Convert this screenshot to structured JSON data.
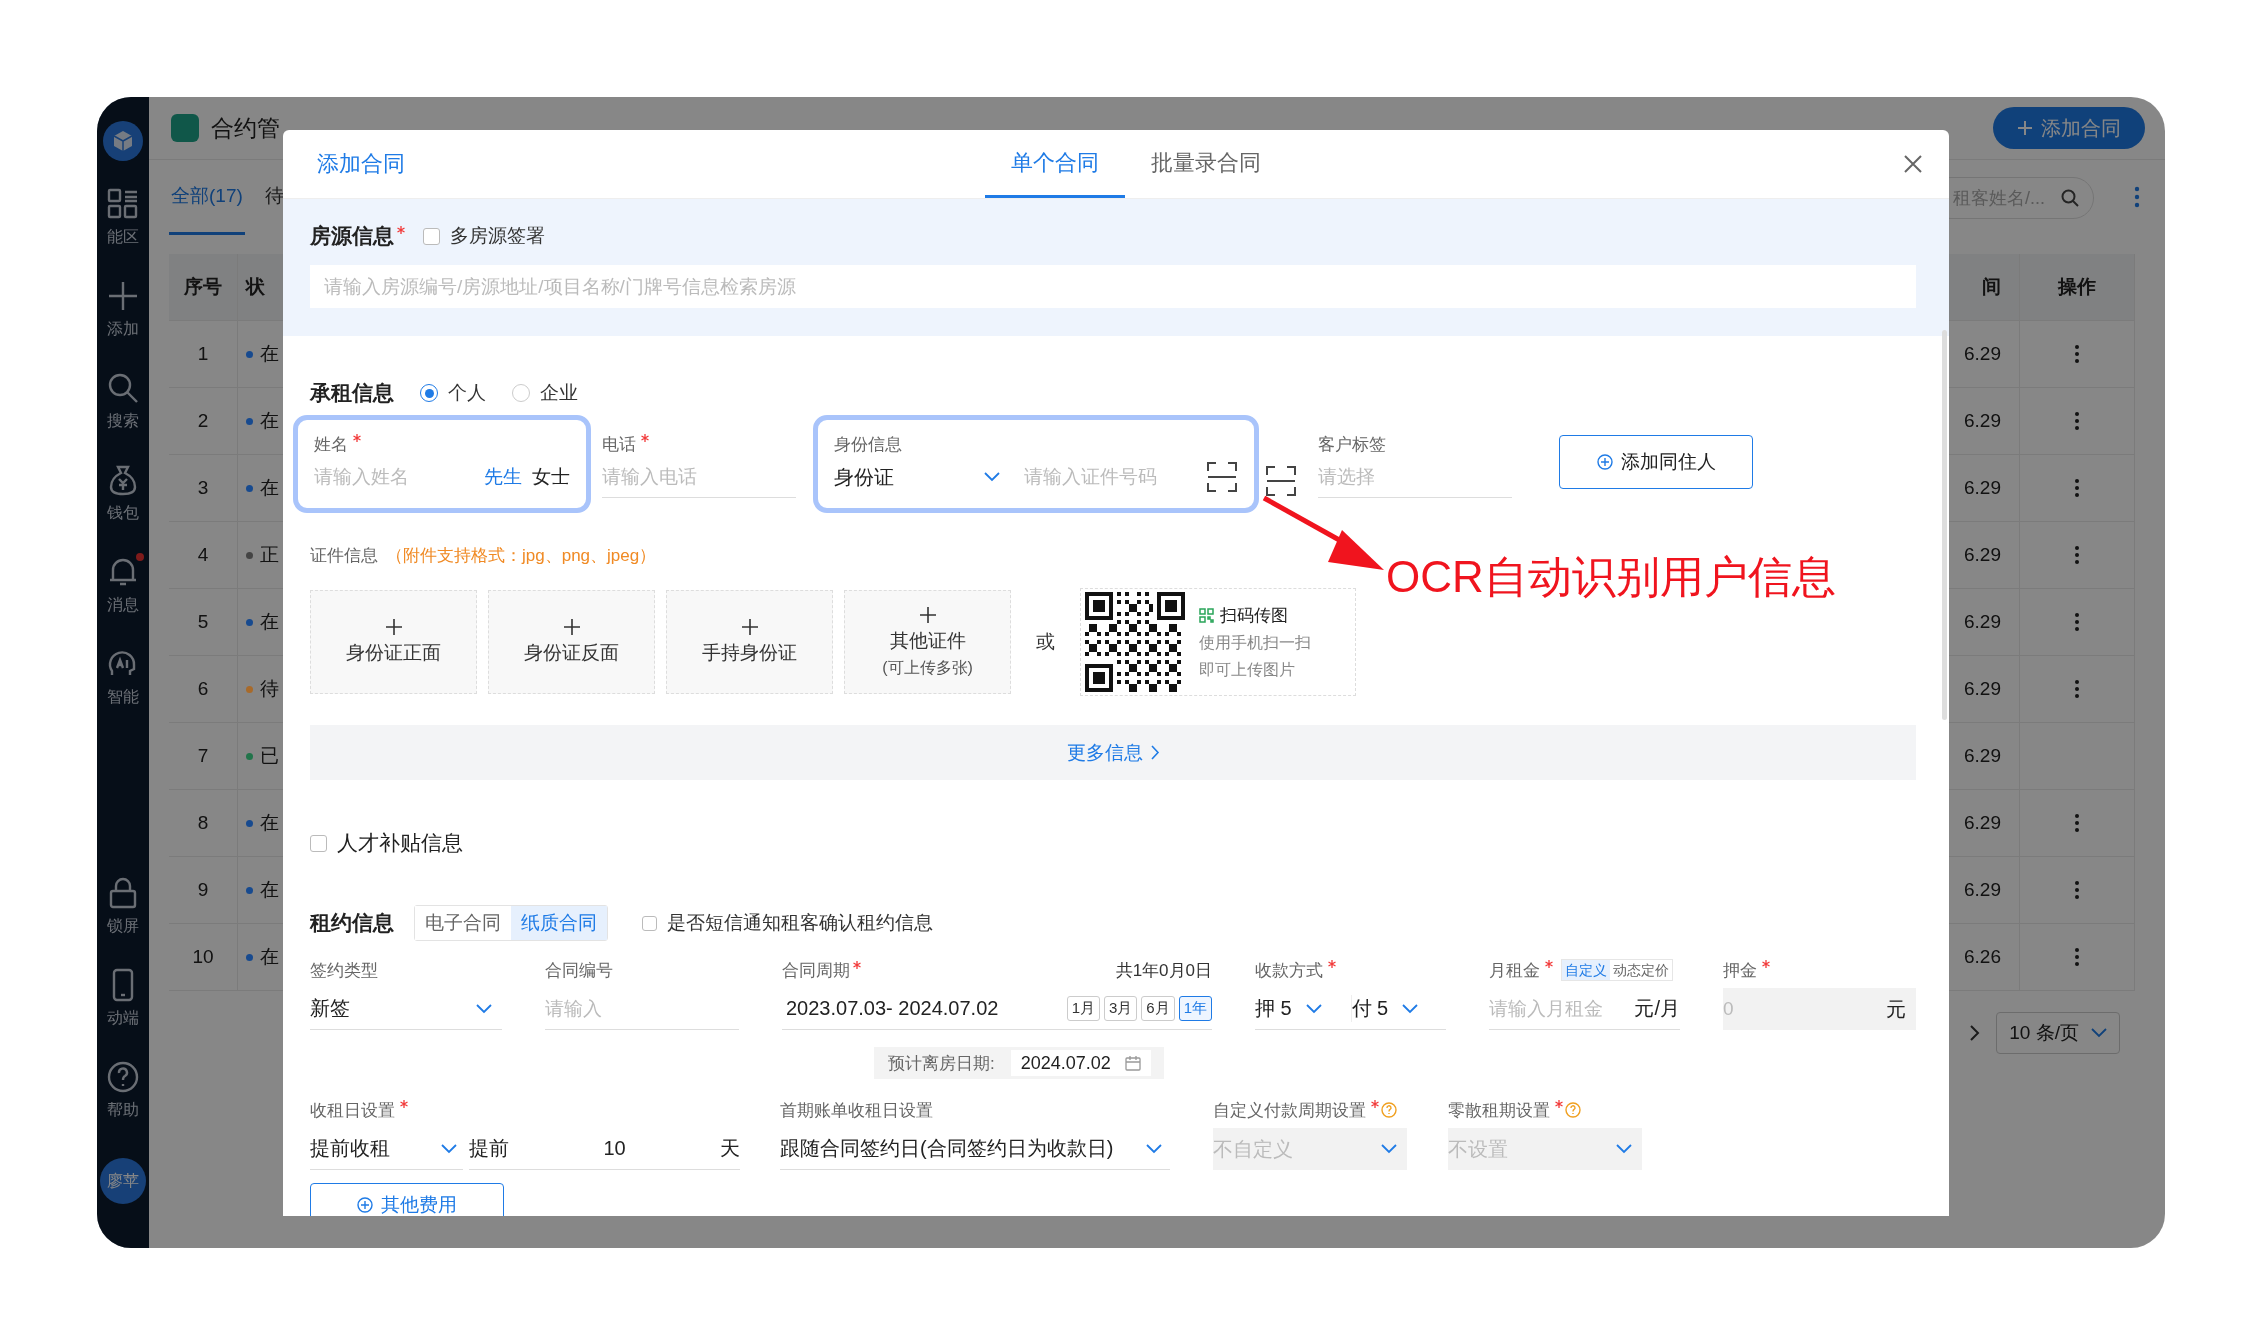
{
  "sidebar": {
    "items": [
      {
        "kind": "grid",
        "label": "能区"
      },
      {
        "kind": "plus",
        "label": "添加"
      },
      {
        "kind": "search",
        "label": "搜索"
      },
      {
        "kind": "wallet",
        "label": "钱包"
      },
      {
        "kind": "bell",
        "label": "消息",
        "badge": true
      },
      {
        "kind": "ai",
        "label": "智能"
      },
      {
        "kind": "lock",
        "label": "锁屏"
      },
      {
        "kind": "phone",
        "label": "动端"
      },
      {
        "kind": "help",
        "label": "帮助"
      }
    ],
    "avatar": "廖苹"
  },
  "header": {
    "title": "合约管",
    "add_button": "添加合同"
  },
  "filter_tabs": [
    {
      "label": "全部(17)",
      "selected": true
    },
    {
      "label": "待",
      "selected": false
    }
  ],
  "search": {
    "placeholder": "租客姓名/..."
  },
  "table": {
    "columns": [
      "序号",
      "状",
      "间",
      "操作"
    ],
    "rows": [
      {
        "index": "1",
        "status": "在",
        "color": "#174a8f",
        "time": "6.29",
        "menu": true
      },
      {
        "index": "2",
        "status": "在",
        "color": "#174a8f",
        "time": "6.29",
        "menu": true
      },
      {
        "index": "3",
        "status": "在",
        "color": "#174a8f",
        "time": "6.29",
        "menu": true
      },
      {
        "index": "4",
        "status": "正",
        "color": "#444444",
        "time": "6.29",
        "menu": true
      },
      {
        "index": "5",
        "status": "在",
        "color": "#174a8f",
        "time": "6.29",
        "menu": true
      },
      {
        "index": "6",
        "status": "待",
        "color": "#a86a2a",
        "time": "6.29",
        "menu": true
      },
      {
        "index": "7",
        "status": "已",
        "color": "#21744a",
        "time": "6.29",
        "menu": false
      },
      {
        "index": "8",
        "status": "在",
        "color": "#174a8f",
        "time": "6.29",
        "menu": true
      },
      {
        "index": "9",
        "status": "在",
        "color": "#174a8f",
        "time": "6.29",
        "menu": true
      },
      {
        "index": "10",
        "status": "在",
        "color": "#174a8f",
        "time": "6.26",
        "menu": true
      }
    ]
  },
  "pagination": {
    "per_page": "10 条/页"
  },
  "modal": {
    "title": "添加合同",
    "tabs": [
      {
        "label": "单个合同",
        "selected": true
      },
      {
        "label": "批量录合同",
        "selected": false
      }
    ],
    "property": {
      "title": "房源信息",
      "required": true,
      "multi": {
        "label": "多房源签署",
        "checked": false
      },
      "placeholder": "请输入房源编号/房源地址/项目名称/门牌号信息检索房源"
    },
    "tenant": {
      "title": "承租信息",
      "types": [
        {
          "label": "个人",
          "selected": true
        },
        {
          "label": "企业",
          "selected": false
        }
      ],
      "name": {
        "label": "姓名",
        "required": true,
        "placeholder": "请输入姓名",
        "highlighted": true,
        "titles": [
          {
            "label": "先生",
            "selected": true
          },
          {
            "label": "女士",
            "selected": false
          }
        ]
      },
      "phone": {
        "label": "电话",
        "required": true,
        "placeholder": "请输入电话",
        "highlighted": false
      },
      "id": {
        "label": "身份信息",
        "type_value": "身份证",
        "placeholder": "请输入证件号码",
        "highlighted": true
      },
      "tags": {
        "label": "客户标签",
        "placeholder": "请选择"
      },
      "add_button": "添加同住人",
      "docs_label": "证件信息",
      "docs_hint": "（附件支持格式：jpg、png、jpeg）",
      "uploads": [
        {
          "label": "身份证正面"
        },
        {
          "label": "身份证反面"
        },
        {
          "label": "手持身份证"
        },
        {
          "label": "其他证件",
          "note": "(可上传多张)"
        }
      ],
      "or": "或",
      "qr": {
        "title": "扫码传图",
        "lines": [
          "使用手机扫一扫",
          "即可上传图片"
        ]
      },
      "more": "更多信息"
    },
    "talent": {
      "label": "人才补贴信息",
      "checked": false
    },
    "lease": {
      "title": "租约信息",
      "contract_types": [
        {
          "label": "电子合同",
          "selected": false
        },
        {
          "label": "纸质合同",
          "selected": true
        }
      ],
      "sms": {
        "label": "是否短信通知租客确认租约信息",
        "checked": false
      },
      "sign_type": {
        "label": "签约类型",
        "value": "新签"
      },
      "contract_no": {
        "label": "合同编号",
        "placeholder": "请输入"
      },
      "period": {
        "label": "合同周期",
        "required": true,
        "total": "共1年0月0日",
        "value": "2023.07.03- 2024.07.02",
        "presets": [
          {
            "label": "1月",
            "selected": false
          },
          {
            "label": "3月",
            "selected": false
          },
          {
            "label": "6月",
            "selected": false
          },
          {
            "label": "1年",
            "selected": true
          }
        ],
        "checkout_label": "预计离房日期:",
        "checkout_value": "2024.07.02"
      },
      "payment": {
        "label": "收款方式",
        "required": true,
        "deposit_prefix": "押",
        "deposit": "5",
        "pay_prefix": "付",
        "pay": "5"
      },
      "rent": {
        "label": "月租金",
        "required": true,
        "modes": [
          {
            "label": "自定义",
            "selected": true
          },
          {
            "label": "动态定价",
            "selected": false
          }
        ],
        "placeholder": "请输入月租金",
        "unit": "元/月"
      },
      "deposit": {
        "label": "押金",
        "required": true,
        "placeholder": "0",
        "unit": "元",
        "disabled": true
      },
      "due": {
        "label": "收租日设置",
        "required": true,
        "value": "提前收租",
        "prefix": "提前",
        "days": "10",
        "unit": "天"
      },
      "first_bill": {
        "label": "首期账单收租日设置",
        "value": "跟随合同签约日(合同签约日为收款日)"
      },
      "custom_cycle": {
        "label": "自定义付款周期设置",
        "required": true,
        "help": true,
        "placeholder": "不自定义",
        "disabled": true
      },
      "scattered": {
        "label": "零散租期设置",
        "required": true,
        "help": true,
        "placeholder": "不设置",
        "disabled": true
      },
      "other_fees": "其他费用"
    }
  },
  "annotation": {
    "text": "OCR自动识别用户信息"
  }
}
